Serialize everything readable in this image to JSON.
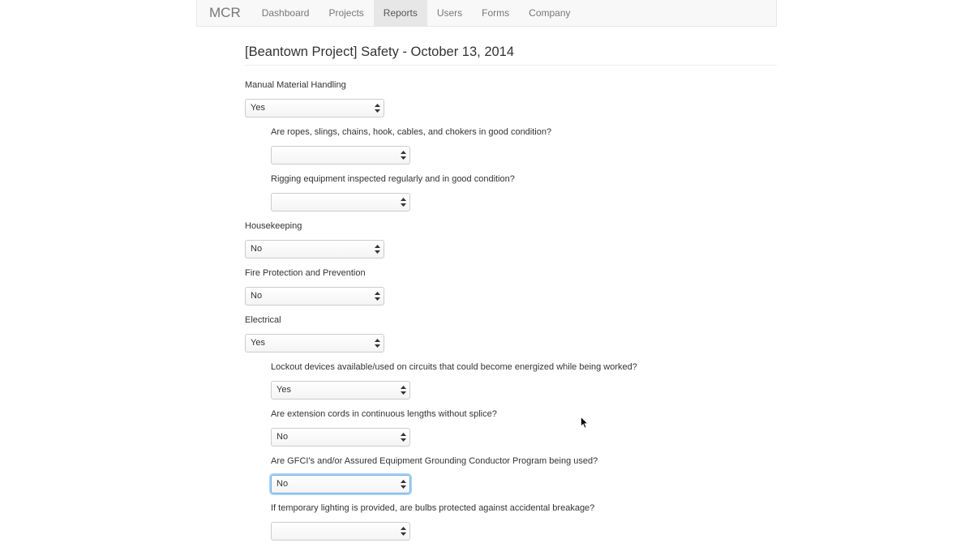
{
  "nav": {
    "brand": "MCR",
    "items": [
      "Dashboard",
      "Projects",
      "Reports",
      "Users",
      "Forms",
      "Company"
    ],
    "active_index": 2
  },
  "page_title": "[Beantown Project] Safety - October 13, 2014",
  "fields": [
    {
      "label": "Manual Material Handling",
      "value": "Yes",
      "level": 0
    },
    {
      "label": "Are ropes, slings, chains, hook, cables, and chokers in good condition?",
      "value": "",
      "level": 1
    },
    {
      "label": "Rigging equipment inspected regularly and in good condition?",
      "value": "",
      "level": 1
    },
    {
      "label": "Housekeeping",
      "value": "No",
      "level": 0
    },
    {
      "label": "Fire Protection and Prevention",
      "value": "No",
      "level": 0
    },
    {
      "label": "Electrical",
      "value": "Yes",
      "level": 0
    },
    {
      "label": "Lockout devices available/used on circuits that could become energized while being worked?",
      "value": "Yes",
      "level": 1
    },
    {
      "label": "Are extension cords in continuous lengths without splice?",
      "value": "No",
      "level": 1
    },
    {
      "label": "Are GFCI's and/or Assured Equipment Grounding Conductor Program being used?",
      "value": "No",
      "level": 1,
      "focused": true
    },
    {
      "label": "If temporary lighting is provided, are bulbs protected against accidental breakage?",
      "value": "",
      "level": 1
    }
  ]
}
